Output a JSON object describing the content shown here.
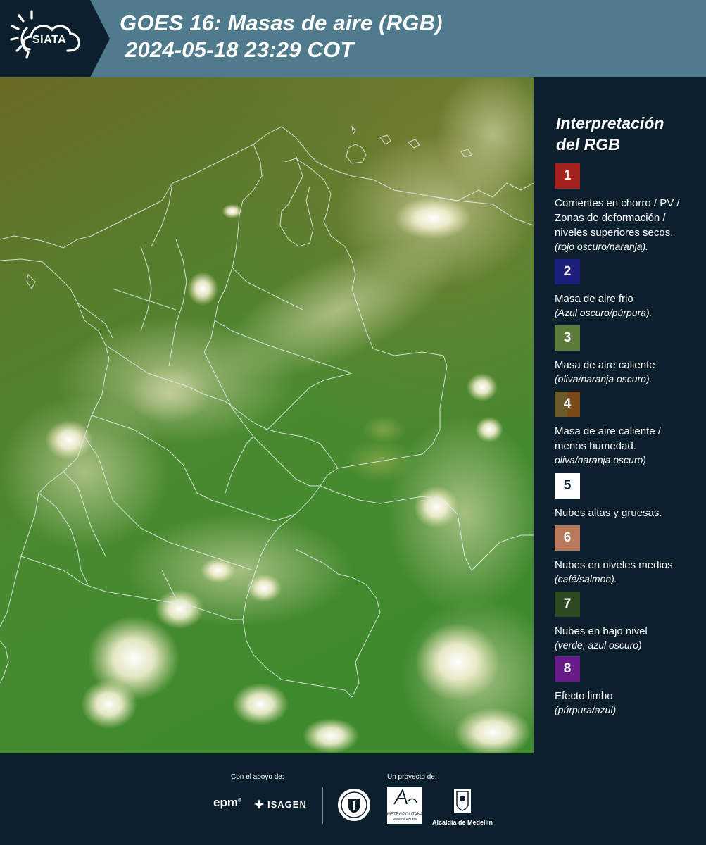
{
  "header": {
    "logo_text": "SIATA",
    "title_line1": "GOES 16: Masas de aire (RGB)",
    "title_line2": "2024-05-18 23:29 COT"
  },
  "legend": {
    "title_line1": "Interpretación",
    "title_line2": "del RGB",
    "items": [
      {
        "num": "1",
        "color": "#a3231f",
        "label": "Corrientes en chorro / PV / Zonas de deformación / niveles superiores secos.",
        "note": "(rojo oscuro/naranja)."
      },
      {
        "num": "2",
        "color": "#1c1f7c",
        "label": "Masa de aire frio",
        "note": "(Azul oscuro/púrpura)."
      },
      {
        "num": "3",
        "color": "#5d7c3b",
        "label": "Masa de aire caliente",
        "note": "(oliva/naranja oscuro)."
      },
      {
        "num": "4",
        "color": "#6a5a2a",
        "color2": "#7a4a18",
        "label": "Masa de aire caliente / menos humedad.",
        "note": "oliva/naranja oscuro)"
      },
      {
        "num": "5",
        "color": "#ffffff",
        "label": "Nubes altas y gruesas.",
        "note": ""
      },
      {
        "num": "6",
        "color": "#b87a5a",
        "label": "Nubes en niveles medios",
        "note": "(café/salmon)."
      },
      {
        "num": "7",
        "color": "#2f4a22",
        "label": "Nubes en bajo nivel",
        "note": "(verde, azul oscuro)"
      },
      {
        "num": "8",
        "color": "#6a1b8a",
        "label": "Efecto limbo",
        "note": "(púrpura/azul)"
      }
    ]
  },
  "footer": {
    "support_label": "Con el apoyo de:",
    "project_label": "Un proyecto de:",
    "epm": "epm",
    "isagen": "ISAGEN",
    "metropolitana_line1": "METROPOLITANA",
    "metropolitana_line2": "Valle de Aburrá",
    "alcaldia": "Alcaldía de Medellín"
  }
}
